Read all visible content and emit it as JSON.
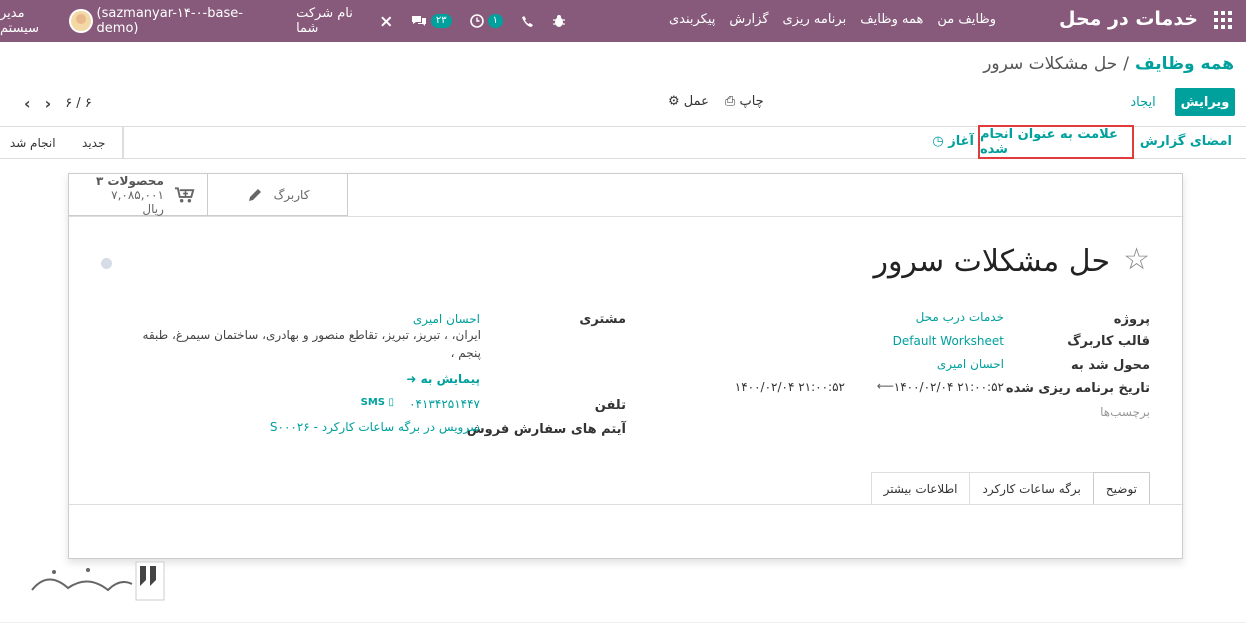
{
  "navbar": {
    "brand": "خدمات در محل",
    "menu": [
      "وظایف من",
      "همه وظایف",
      "برنامه ریزی",
      "گزارش",
      "پیکربندی"
    ],
    "bug_icon": "bug-icon",
    "phone_icon": "phone-icon",
    "activity_count": "۱",
    "messages_count": "۲۳",
    "company": "نام شرکت شما",
    "user": "مدیر سیستم",
    "database": "(sazmanyar-۱۴-۰-base-demo)"
  },
  "breadcrumb": {
    "parent": "همه وظایف",
    "separator": "/",
    "current": "حل مشکلات سرور"
  },
  "controls": {
    "edit": "ویرایش",
    "create": "ایجاد",
    "print": "چاپ",
    "action": "عمل",
    "pager": "۶ / ۶"
  },
  "statusbar": {
    "sign_report": "امضای گزارش",
    "mark_done": "علامت به عنوان انجام شده",
    "start": "آغاز",
    "stages": [
      "جدید",
      "انجام شد"
    ]
  },
  "buttons": {
    "products_count": "۳ محصولات",
    "products_amount": "۷,۰۸۵,۰۰۱ ریال",
    "worksheet": "کاربرگ"
  },
  "record": {
    "title": "حل مشکلات سرور",
    "fields_right": {
      "project_label": "پروژه",
      "project_value": "خدمات درب محل",
      "template_label": "قالب کاربرگ",
      "template_value": "Default Worksheet",
      "assignee_label": "محول شد به",
      "assignee_value": "احسان امیری",
      "planned_label": "تاریخ برنامه ریزی شده",
      "planned_start": "۱۴۰۰/۰۲/۰۴ ۲۱:۰۰:۵۲",
      "planned_end": "۱۴۰۰/۰۲/۰۴ ۲۱:۰۰:۵۲",
      "tags_placeholder": "برچسب‌ها"
    },
    "fields_left": {
      "customer_label": "مشتری",
      "customer_name": "احسان امیری",
      "customer_address": "ایران، ، تبریز، تبریز، تقاطع منصور و بهادری، ساختمان سیمرغ، طبقه پنجم ،",
      "navigate": "پیمایش به",
      "phone_label": "تلفن",
      "phone_value": "۰۴۱۳۴۲۵۱۴۴۷",
      "sms": "SMS",
      "sale_item_label": "آیتم های سفارش فروش",
      "sale_item_value": "S۰۰۰۲۶ - سرویس در برگه ساعات کارکرد"
    },
    "tabs": [
      "توضیح",
      "برگه ساعات کارکرد",
      "اطلاعات بیشتر"
    ]
  },
  "colors": {
    "navbar": "#875a7b",
    "primary": "#00a09d",
    "highlight": "#e23b3b"
  }
}
